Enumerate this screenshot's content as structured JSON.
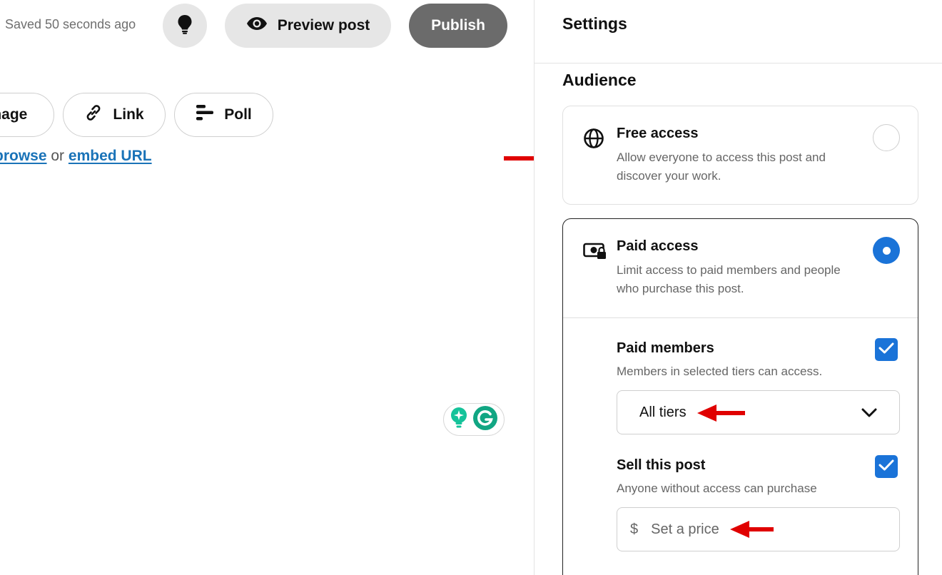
{
  "toolbar": {
    "saved_status": "Saved 50 seconds ago",
    "preview_label": "Preview post",
    "publish_label": "Publish"
  },
  "media": {
    "image_label": "Image",
    "link_label": "Link",
    "poll_label": "Poll",
    "browse_link": "browse",
    "or_text": "or",
    "embed_link": "embed URL"
  },
  "settings": {
    "title": "Settings",
    "audience_title": "Audience",
    "free_access": {
      "title": "Free access",
      "description": "Allow everyone to access this post and discover your work.",
      "selected": false
    },
    "paid_access": {
      "title": "Paid access",
      "description": "Limit access to paid members and people who purchase this post.",
      "selected": true,
      "paid_members": {
        "title": "Paid members",
        "description": "Members in selected tiers can access.",
        "checked": true,
        "tier_value": "All tiers"
      },
      "sell_post": {
        "title": "Sell this post",
        "description": "Anyone without access can purchase",
        "checked": true,
        "currency_symbol": "$",
        "price_placeholder": "Set a price"
      }
    }
  },
  "colors": {
    "accent_blue": "#1a73d8",
    "link_blue": "#1a73b8",
    "publish_gray": "#6b6b6b",
    "annotation_red": "#e00000",
    "grammarly_green": "#15c39a"
  }
}
